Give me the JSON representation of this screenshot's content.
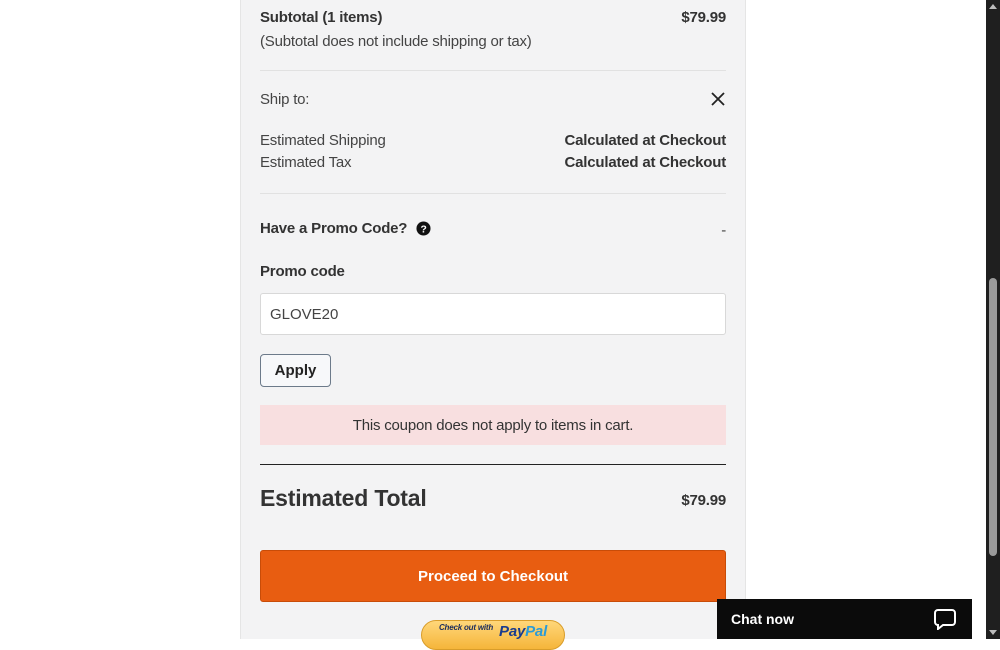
{
  "subtotal": {
    "label": "Subtotal (1 items)",
    "amount": "$79.99",
    "note": "(Subtotal does not include shipping or tax)"
  },
  "shipping": {
    "ship_to_label": "Ship to:",
    "close_icon": "close-icon",
    "estimated_shipping_label": "Estimated Shipping",
    "estimated_shipping_value": "Calculated at Checkout",
    "estimated_tax_label": "Estimated Tax",
    "estimated_tax_value": "Calculated at Checkout"
  },
  "promo": {
    "heading": "Have a Promo Code?",
    "help_icon": "question-circle-icon",
    "toggle": "-",
    "field_label": "Promo code",
    "value": "GLOVE20",
    "apply_label": "Apply",
    "error_message": "This coupon does not apply to items in cart."
  },
  "total": {
    "label": "Estimated Total",
    "amount": "$79.99"
  },
  "checkout": {
    "button_label": "Proceed to Checkout",
    "paypal_small": "Check out with",
    "paypal_brand_a": "Pay",
    "paypal_brand_b": "Pal"
  },
  "chat": {
    "label": "Chat now",
    "icon": "chat-bubble-icon"
  },
  "colors": {
    "accent": "#e85d11",
    "alert_bg": "#f8dfe0",
    "panel_bg": "#f3f3f4"
  }
}
